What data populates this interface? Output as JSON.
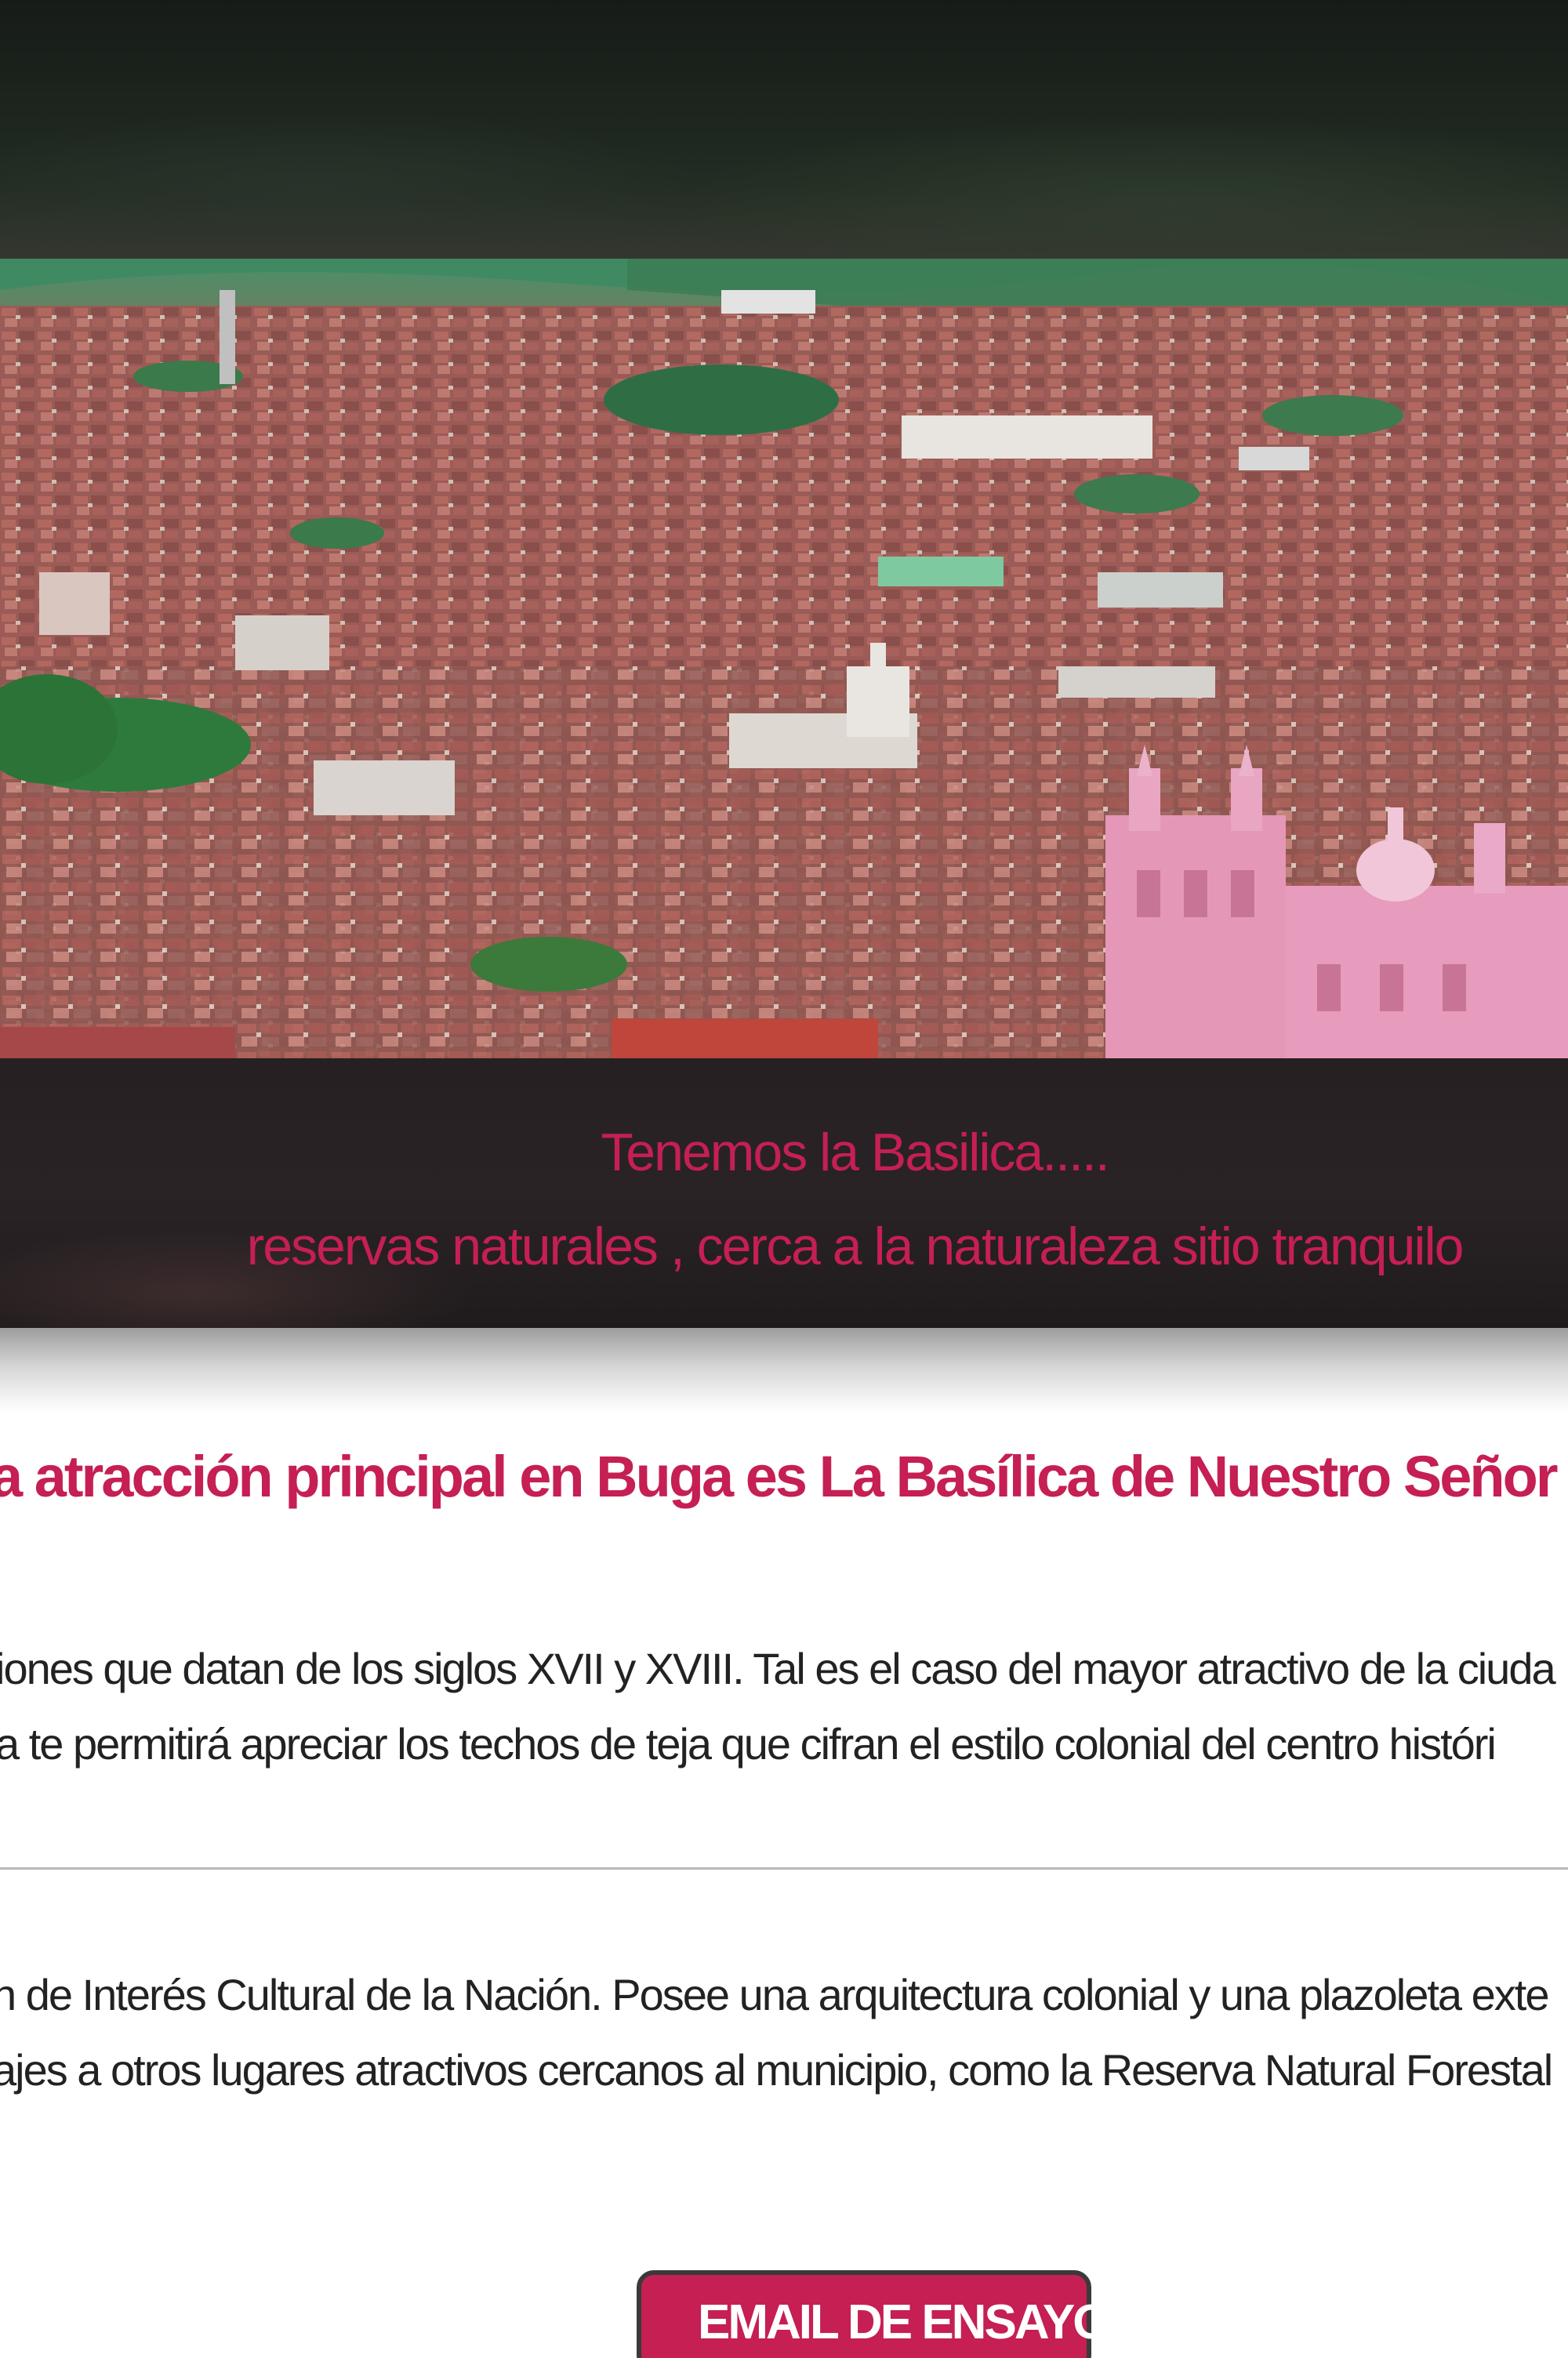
{
  "hero": {
    "caption_line1": "Tenemos la Basilica.....",
    "caption_line2": "reservas naturales , cerca a la naturaleza sitio tranquilo"
  },
  "article": {
    "headline": "a atracción principal en Buga es La Basílica de Nuestro Señor de los M",
    "paragraph1_line1": "iones que datan de los siglos XVII y XVIII. Tal es el caso del mayor atractivo de la ciuda",
    "paragraph1_line2": "a te permitirá apreciar los techos de teja que cifran el estilo colonial del centro históri",
    "paragraph2_line1": "n de Interés Cultural de la Nación. Posee una arquitectura colonial y una plazoleta exte",
    "paragraph2_line2": "ajes a otros lugares atractivos cercanos al municipio, como la Reserva Natural Forestal"
  },
  "cta": {
    "email_button_label": "EMAIL DE ENSAYO",
    "icon": "envelope-icon"
  },
  "colors": {
    "accent": "#c51f54",
    "text": "#222222",
    "dark_band": "#262022"
  }
}
